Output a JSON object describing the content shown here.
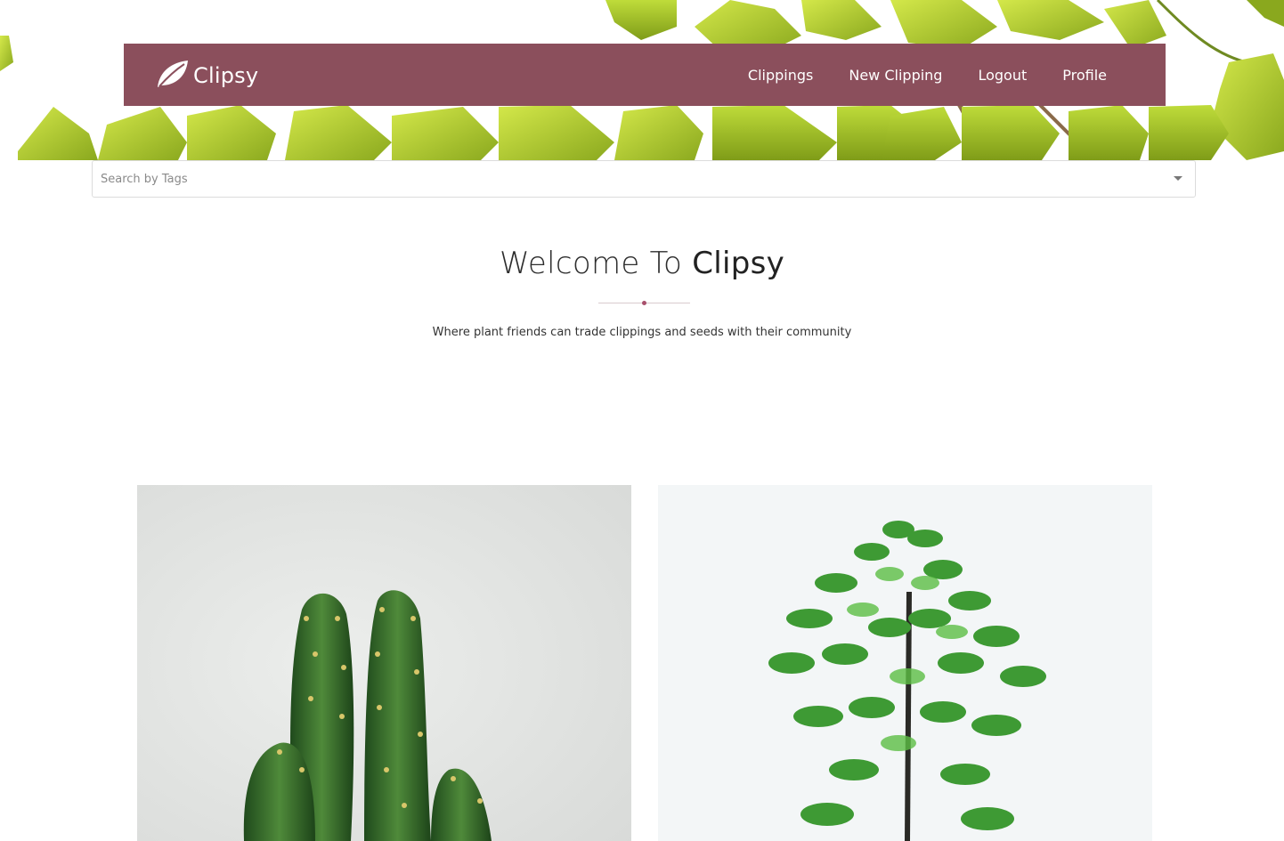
{
  "brand": {
    "name": "Clipsy",
    "logo_icon": "leaf-icon"
  },
  "nav": {
    "items": [
      {
        "label": "Clippings"
      },
      {
        "label": "New Clipping"
      },
      {
        "label": "Logout"
      },
      {
        "label": "Profile"
      }
    ]
  },
  "search": {
    "placeholder": "Search by Tags",
    "value": "",
    "dropdown_icon": "caret-down-icon"
  },
  "welcome": {
    "prefix": "Welcome To ",
    "emphasis": "Clipsy"
  },
  "tagline": "Where plant friends can trade clippings and seeds with their community",
  "colors": {
    "navbar": "#8b4f5c",
    "accent_dot": "#a8506c",
    "leaf_green": "#a7c62e"
  },
  "cards": [
    {
      "image": "cactus-photo"
    },
    {
      "image": "umbrella-plant-photo"
    }
  ]
}
